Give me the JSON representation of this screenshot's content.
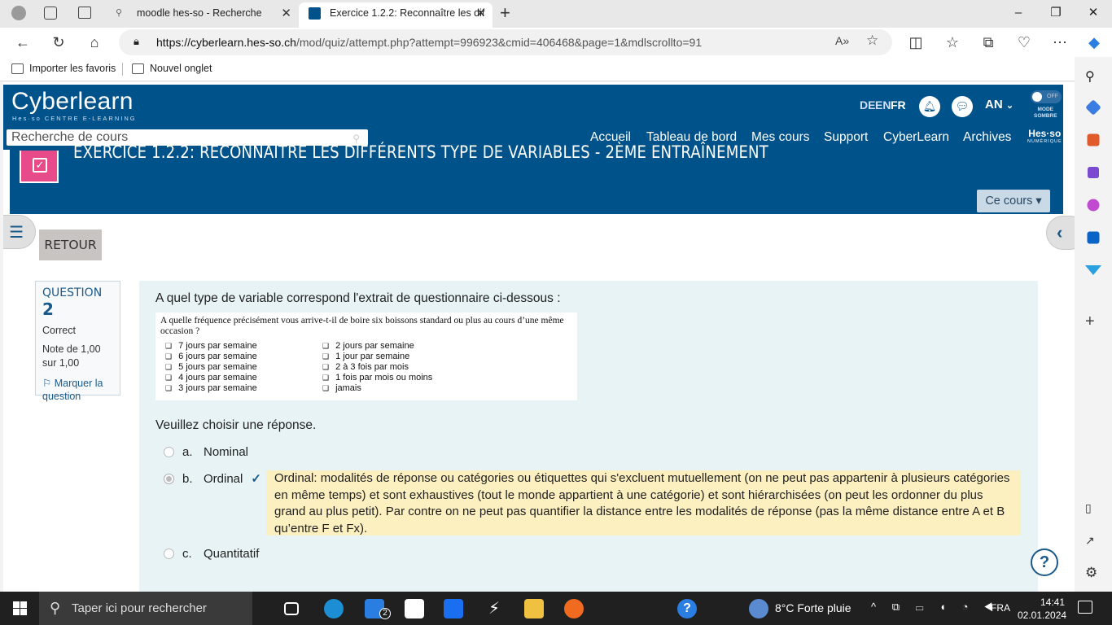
{
  "browser": {
    "tabs": [
      {
        "label": "moodle hes-so - Recherche"
      },
      {
        "label": "Exercice 1.2.2: Reconnaître les dif"
      }
    ],
    "url_host": "https://cyberlearn.hes-so.ch",
    "url_path": "/mod/quiz/attempt.php?attempt=996923&cmid=406468&page=1&mdlscrollto=91",
    "favorites": [
      "Importer les favoris",
      "Nouvel onglet"
    ]
  },
  "site": {
    "logo": "Cyberlearn",
    "logo_sub": "Hes·so CENTRE E-LEARNING",
    "search_placeholder": "Recherche de cours",
    "languages": [
      "DE",
      "EN",
      "FR"
    ],
    "user_initials": "AN",
    "mode_toggle": "OFF",
    "mode_label_1": "MODE",
    "mode_label_2": "SOMBRE",
    "nav": [
      "Accueil",
      "Tableau de bord",
      "Mes cours",
      "Support",
      "CyberLearn",
      "Archives"
    ],
    "hesso_badge": "Hes·so",
    "hesso_badge_sub": "NUMÉRIQUE"
  },
  "page": {
    "title": "EXERCICE 1.2.2: RECONNAÎTRE LES DIFFÉRENTS TYPE DE VARIABLES - 2ÈME ENTRAÎNEMENT",
    "ce_cours": "Ce cours ▾",
    "retour": "RETOUR"
  },
  "question_info": {
    "label": "QUESTION",
    "number": "2",
    "status": "Correct",
    "grade_line1": "Note de 1,00",
    "grade_line2": "sur 1,00",
    "flag": "Marquer la question"
  },
  "question": {
    "text": "A quel type de variable correspond l'extrait de questionnaire ci-dessous :",
    "image_heading": "A quelle fréquence précisément vous arrive-t-il de boire six boissons standard ou plus au cours d’une même occasion ?",
    "image_col1": [
      "7 jours par semaine",
      "6 jours par semaine",
      "5 jours par semaine",
      "4 jours par semaine",
      "3 jours par semaine"
    ],
    "image_col2": [
      "2 jours par semaine",
      "1 jour par semaine",
      "2 à 3 fois par mois",
      "1 fois par mois ou moins",
      "jamais"
    ],
    "choose": "Veuillez choisir une réponse.",
    "answers": [
      {
        "letter": "a.",
        "label": "Nominal",
        "selected": false
      },
      {
        "letter": "b.",
        "label": "Ordinal",
        "selected": true
      },
      {
        "letter": "c.",
        "label": "Quantitatif",
        "selected": false
      }
    ],
    "feedback": "Ordinal: modalités de réponse ou catégories ou étiquettes qui s'excluent mutuellement (on ne peut pas appartenir à plusieurs catégories en même temps) et sont exhaustives (tout le monde appartient à une catégorie) et sont hiérarchisées (on peut les ordonner du plus grand au plus petit). Par contre on ne peut pas quantifier la distance entre les modalités de réponse (pas la même distance entre A et B qu’entre F et Fx).",
    "help": "?"
  },
  "taskbar": {
    "search_placeholder": "Taper ici pour rechercher",
    "mail_badge": "2",
    "weather": "8°C  Forte pluie",
    "lang": "FRA",
    "time": "14:41",
    "date": "02.01.2024"
  },
  "colors": {
    "brand_blue": "#00528a",
    "feedback_bg": "#fcefc0",
    "question_bg": "#e7f3f5",
    "accent_pink": "#e84b8a"
  }
}
